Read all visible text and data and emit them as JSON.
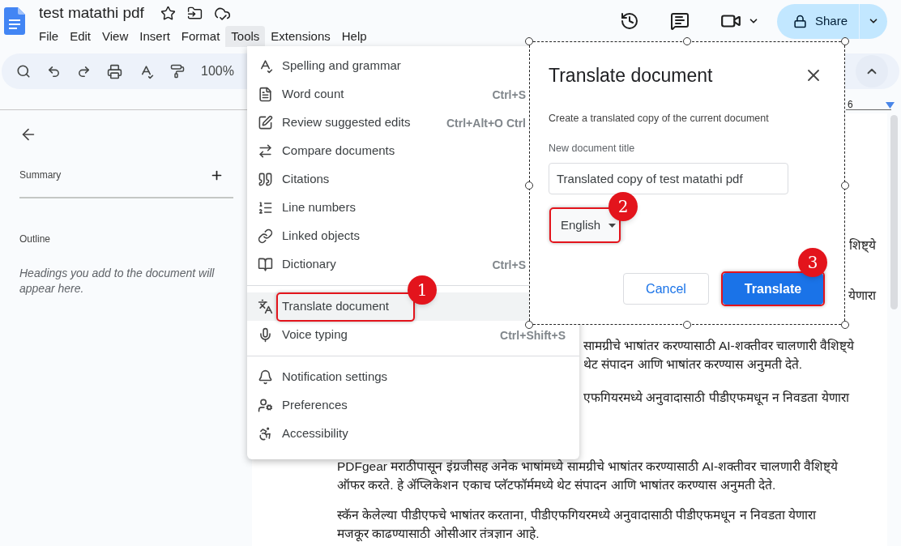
{
  "app": {
    "title": "test matathi pdf"
  },
  "menu_bar": [
    {
      "label": "File",
      "selected": false
    },
    {
      "label": "Edit",
      "selected": false
    },
    {
      "label": "View",
      "selected": false
    },
    {
      "label": "Insert",
      "selected": false
    },
    {
      "label": "Format",
      "selected": false
    },
    {
      "label": "Tools",
      "selected": true
    },
    {
      "label": "Extensions",
      "selected": false
    },
    {
      "label": "Help",
      "selected": false
    }
  ],
  "share_button": {
    "label": "Share"
  },
  "toolbar": {
    "zoom": "100%"
  },
  "sidebar": {
    "summary": "Summary",
    "outline": "Outline",
    "outline_hint": "Headings you add to the document will appear here."
  },
  "ruler": {
    "label": "6"
  },
  "tools_menu": {
    "sections": [
      {
        "items": [
          {
            "label": "Spelling and grammar",
            "selected": false
          },
          {
            "label": "Word count",
            "shortcut": "Ctrl+S",
            "selected": false
          },
          {
            "label": "Review suggested edits",
            "shortcut": "Ctrl+Alt+O Ctrl",
            "selected": false
          },
          {
            "label": "Compare documents",
            "selected": false
          },
          {
            "label": "Citations",
            "selected": false
          },
          {
            "label": "Line numbers",
            "selected": false
          },
          {
            "label": "Linked objects",
            "selected": false
          },
          {
            "label": "Dictionary",
            "shortcut": "Ctrl+S",
            "selected": false
          }
        ]
      },
      {
        "items": [
          {
            "label": "Translate document",
            "selected": true,
            "annotation": "1"
          },
          {
            "label": "Voice typing",
            "shortcut": "Ctrl+Shift+S",
            "selected": false
          }
        ]
      },
      {
        "items": [
          {
            "label": "Notification settings",
            "selected": false
          },
          {
            "label": "Preferences",
            "selected": false
          },
          {
            "label": "Accessibility",
            "selected": false
          }
        ]
      }
    ]
  },
  "translate_dialog": {
    "title": "Translate document",
    "description": "Create a translated copy of the current document",
    "field_label": "New document title",
    "field_value": "Translated copy of test matathi pdf",
    "language": {
      "label": "English",
      "annotation": "2"
    },
    "buttons": [
      {
        "label": "Cancel",
        "kind": "secondary"
      },
      {
        "label": "Translate",
        "kind": "primary",
        "annotation": "3"
      }
    ]
  },
  "document": {
    "paragraphs": [
      {
        "lines": [
          {
            "kind": "tail",
            "text": "शिष्ट्ये"
          }
        ]
      },
      {
        "lines": [
          {
            "kind": "tail",
            "text": "येणारा"
          }
        ]
      },
      {
        "lines": [
          {
            "kind": "cut",
            "text": "सामग्रीचे भाषांतर करण्यासाठी AI-शक्तीवर चालणारी वैशिष्ट्ये"
          },
          {
            "kind": "cut",
            "text": "थेट संपादन आणि भाषांतर करण्यास अनुमती देते."
          }
        ]
      },
      {
        "lines": [
          {
            "kind": "cut",
            "text": "एफगियरमध्ये अनुवादासाठी पीडीएफमधून न निवडता येणारा"
          }
        ]
      },
      {
        "lines": [
          {
            "kind": "full",
            "text": "PDFgear मराठीपासून इंग्रजीसह अनेक भाषांमध्ये सामग्रीचे भाषांतर करण्यासाठी AI-शक्तीवर चालणारी वैशिष्ट्ये"
          },
          {
            "kind": "full",
            "text": "ऑफर करते. हे ॲप्लिकेशन एकाच प्लॅटफॉर्ममध्ये थेट संपादन आणि भाषांतर करण्यास अनुमती देते."
          }
        ]
      },
      {
        "lines": [
          {
            "kind": "full",
            "text": "स्कॅन केलेल्या पीडीएफचे भाषांतर करताना, पीडीएफगियरमध्ये अनुवादासाठी पीडीएफमधून न निवडता येणारा"
          },
          {
            "kind": "full",
            "text": "मजकूर काढण्यासाठी ओसीआर तंत्रज्ञान आहे."
          }
        ]
      }
    ]
  }
}
